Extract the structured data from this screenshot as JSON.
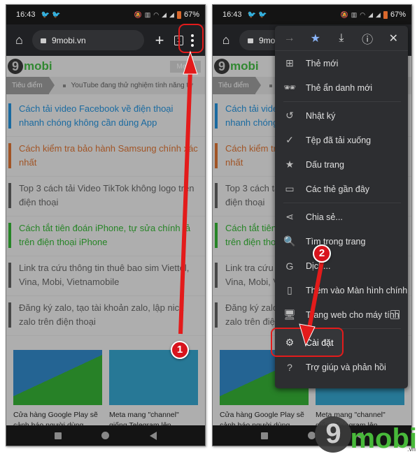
{
  "status_bar": {
    "time": "16:43",
    "twitter_icons": [
      "twitter-icon",
      "twitter-icon"
    ],
    "battery": "67%"
  },
  "toolbar": {
    "url": "9mobi.vn",
    "tab_count": "1"
  },
  "site": {
    "logo_text": "mobi",
    "logo_digit": "9",
    "menu_button": "Menu",
    "ticker_tag": "Tiêu điểm",
    "ticker_text": "YouTube đang thử nghiệm tính năng tự"
  },
  "news": [
    {
      "title": "Cách tải video Facebook về điện thoại nhanh chóng không cần dùng App",
      "color": "#1f7fbf"
    },
    {
      "title": "Cách kiểm tra bảo hành Samsung chính xác nhất",
      "color": "#c0652d"
    },
    {
      "title": "Top 3 cách tải Video TikTok không logo trên điện thoại",
      "color": "#555555"
    },
    {
      "title": "Cách tắt tiên đoán iPhone, tự sửa chính tả trên điện thoại iPhone",
      "color": "#2e9e2e"
    },
    {
      "title": "Link tra cứu thông tin thuê bao sim Viettel, Vina, Mobi, Vietnamobile",
      "color": "#555555"
    },
    {
      "title": "Đăng ký zalo, tạo tài khoản zalo, lập nick zalo trên điện thoại",
      "color": "#555555"
    }
  ],
  "cards": [
    {
      "title": "Cửa hàng Google Play sẽ cảnh báo người dùng trước khi tải ứng dụng lỗi"
    },
    {
      "title": "Meta mang \"channel\" giống Telegram lên Instagram"
    }
  ],
  "menu": {
    "top_icons": [
      "forward-icon",
      "bookmark-star-icon",
      "download-icon",
      "info-icon",
      "close-icon"
    ],
    "items": [
      {
        "label": "Thẻ mới",
        "icon": "new-tab-icon"
      },
      {
        "label": "Thẻ ẩn danh mới",
        "icon": "incognito-icon"
      },
      {
        "label": "Nhật ký",
        "icon": "history-icon"
      },
      {
        "label": "Tệp đã tải xuống",
        "icon": "downloads-icon"
      },
      {
        "label": "Dấu trang",
        "icon": "bookmarks-icon"
      },
      {
        "label": "Các thẻ gần đây",
        "icon": "recent-tabs-icon"
      },
      {
        "label": "Chia sẻ...",
        "icon": "share-icon"
      },
      {
        "label": "Tìm trong trang",
        "icon": "find-in-page-icon"
      },
      {
        "label": "Dịch...",
        "icon": "translate-icon"
      },
      {
        "label": "Thêm vào Màn hình chính",
        "icon": "add-to-home-icon"
      },
      {
        "label": "Trang web cho máy tính",
        "icon": "desktop-icon"
      },
      {
        "label": "Cài đặt",
        "icon": "settings-icon"
      },
      {
        "label": "Trợ giúp và phản hồi",
        "icon": "help-icon"
      }
    ]
  },
  "annotations": {
    "step1": "1",
    "step2": "2",
    "highlight_color": "#e31b1b"
  },
  "watermark": {
    "digit": "9",
    "text": "mobi",
    "tld": ".vn"
  }
}
